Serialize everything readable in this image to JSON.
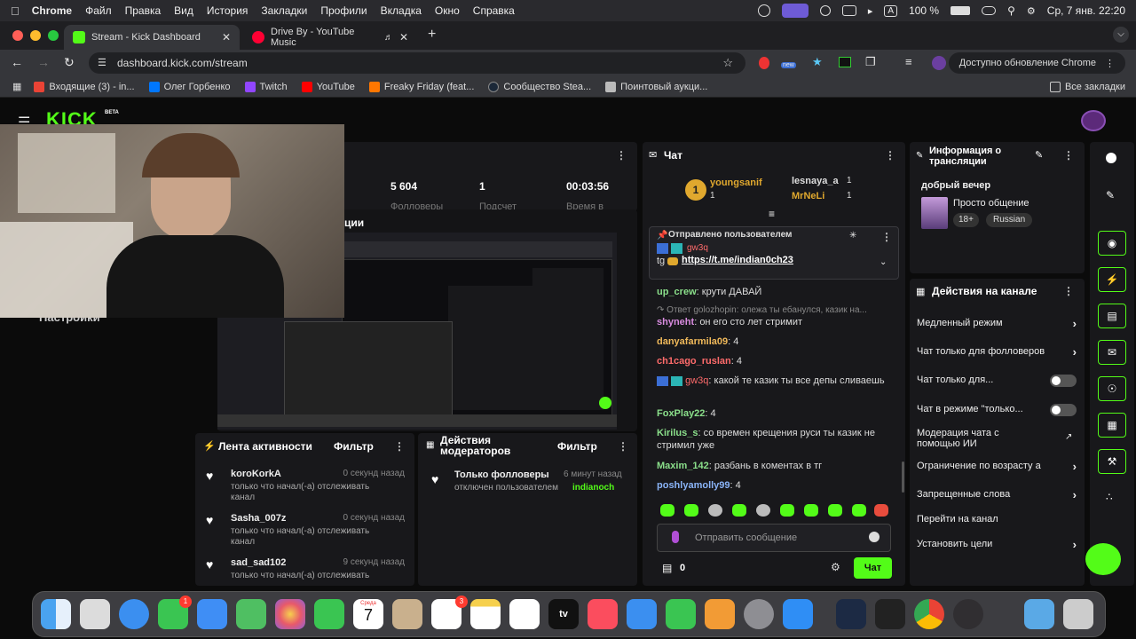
{
  "menubar": {
    "app": "Chrome",
    "items": [
      "Файл",
      "Правка",
      "Вид",
      "История",
      "Закладки",
      "Профили",
      "Вкладка",
      "Окно",
      "Справка"
    ],
    "battery": "100 %",
    "lang": "A",
    "datetime": "Ср, 7 янв.  22:20"
  },
  "tabs": [
    {
      "title": "Stream - Kick Dashboard",
      "active": true
    },
    {
      "title": "Drive By - YouTube Music",
      "active": false
    }
  ],
  "toolbar": {
    "url": "dashboard.kick.com/stream",
    "update": "Доступно обновление Chrome",
    "ext_badge": "new"
  },
  "bookmarks": [
    "Входящие (3) - in...",
    "Олег Горбенко",
    "Twitch",
    "YouTube",
    "Freaky Friday (feat...",
    "Сообщество Stea...",
    "Поинтовый аукци..."
  ],
  "bookmarks_all": "Все закладки",
  "kick": {
    "logo": "KICK",
    "beta": "BETA",
    "settings": "Настройки",
    "preview_title": "ции"
  },
  "stats": [
    {
      "value": "5 604",
      "label": "Фолловеры"
    },
    {
      "value": "1",
      "label": "Подсчет"
    },
    {
      "value": "00:03:56",
      "label": "Время в"
    }
  ],
  "activity": {
    "title": "Лента активности",
    "filter": "Фильтр",
    "items": [
      {
        "name": "koroKorkA",
        "time": "0 секунд назад",
        "desc": "только что начал(-а) отслеживать канал"
      },
      {
        "name": "Sasha_007z",
        "time": "0 секунд назад",
        "desc": "только что начал(-а) отслеживать канал"
      },
      {
        "name": "sad_sad102",
        "time": "9 секунд назад",
        "desc": "только что начал(-а) отслеживать"
      }
    ]
  },
  "modactions": {
    "title": "Действия модераторов",
    "filter": "Фильтр",
    "item": {
      "name": "Только фолловеры",
      "time": "6 минут назад",
      "desc": "отключен пользователем",
      "by": "indianoch"
    }
  },
  "chat": {
    "title": "Чат",
    "top": [
      {
        "rank": "1",
        "name": "youngsanif",
        "count": "1"
      },
      {
        "name": "lesnaya_a",
        "count": "1"
      },
      {
        "name": "MrNeLi",
        "count": "1"
      }
    ],
    "pinned": {
      "header": "Отправлено пользователем",
      "user": "gw3q",
      "prefix": "tg",
      "link": "https://t.me/indian0ch23"
    },
    "reply": "Ответ golozhopin: олежа ты ебанулся, казик на...",
    "messages": [
      {
        "user": "up_crew",
        "color": "#8be08b",
        "text": "крути ДАВАЙ"
      },
      {
        "user": "shyneht",
        "color": "#d98ce0",
        "text": "он его сто лет стримит"
      },
      {
        "user": "danyafarmila09",
        "color": "#f0b95a",
        "text": "4"
      },
      {
        "user": "ch1cago_ruslan",
        "color": "#ff6b6b",
        "text": "4"
      },
      {
        "user": "gw3q",
        "color": "#ff6b6b",
        "text": "какой те казик ты все депы сливаешь"
      },
      {
        "user": "FoxPlay22",
        "color": "#8be08b",
        "text": "4"
      },
      {
        "user": "Kirilus_s",
        "color": "#8be08b",
        "text": "со времен крещения руси ты казик не стримил уже"
      },
      {
        "user": "Maxim_142",
        "color": "#8be08b",
        "text": "разбань в коментах в тг"
      },
      {
        "user": "poshlyamolly99",
        "color": "#8ab4f8",
        "text": "4"
      }
    ],
    "placeholder": "Отправить сообщение",
    "points": "0",
    "send": "Чат"
  },
  "info": {
    "title": "Информация о трансляции",
    "stream_title": "добрый вечер",
    "category": "Просто общение",
    "tags": [
      "18+",
      "Russian"
    ]
  },
  "actions": {
    "title": "Действия на канале",
    "items": [
      "Медленный режим",
      "Чат только для фолловеров",
      "Чат только для...",
      "Чат в режиме \"только...",
      "Модерация чата с помощью ИИ",
      "Ограничение по возрасту а",
      "Запрещенные слова",
      "Перейти на канал",
      "Установить цели"
    ]
  },
  "dock": {
    "calendar_month": "Среда",
    "calendar_day": "7",
    "badges": [
      "1",
      "3"
    ],
    "appletv": "tv"
  },
  "colors": {
    "kick_green": "#53fc18",
    "panel": "#18181b"
  }
}
